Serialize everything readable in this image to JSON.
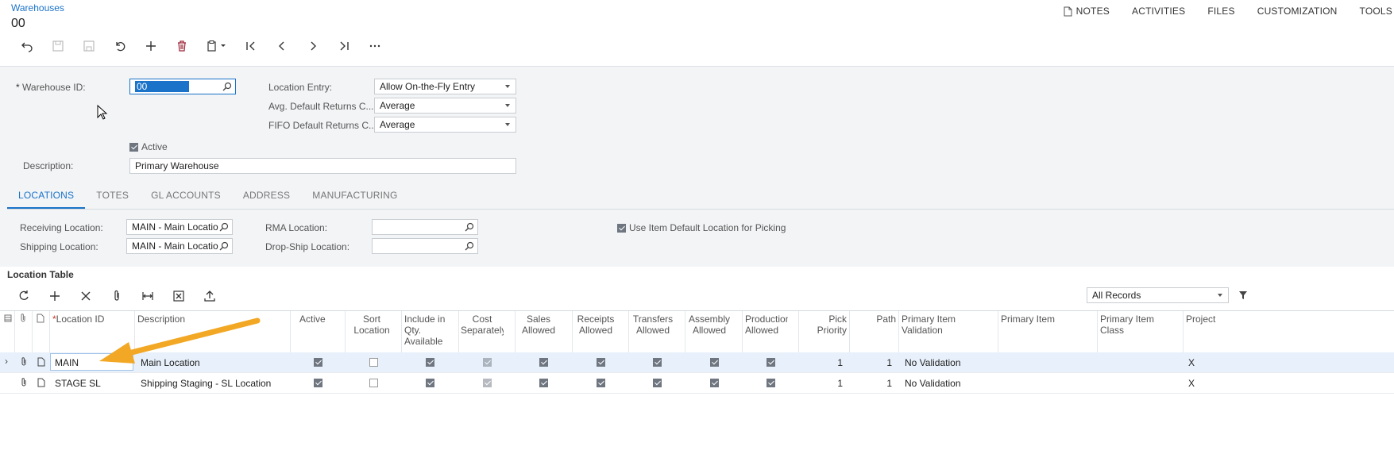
{
  "header": {
    "breadcrumb": "Warehouses",
    "record_title": "00",
    "top_links": [
      "NOTES",
      "ACTIVITIES",
      "FILES",
      "CUSTOMIZATION",
      "TOOLS"
    ]
  },
  "form": {
    "warehouse_id_label": "Warehouse ID:",
    "warehouse_id_value": "00",
    "location_entry_label": "Location Entry:",
    "location_entry_value": "Allow On-the-Fly Entry",
    "avg_returns_label": "Avg. Default Returns C...",
    "avg_returns_value": "Average",
    "fifo_returns_label": "FIFO Default Returns C...",
    "fifo_returns_value": "Average",
    "active_label": "Active",
    "active_checked": true,
    "description_label": "Description:",
    "description_value": "Primary Warehouse"
  },
  "tabs": [
    "LOCATIONS",
    "TOTES",
    "GL ACCOUNTS",
    "ADDRESS",
    "MANUFACTURING"
  ],
  "locations": {
    "receiving_label": "Receiving Location:",
    "receiving_value": "MAIN - Main Location",
    "shipping_label": "Shipping Location:",
    "shipping_value": "MAIN - Main Location",
    "rma_label": "RMA Location:",
    "rma_value": "",
    "dropship_label": "Drop-Ship Location:",
    "dropship_value": "",
    "use_item_default_label": "Use Item Default Location for Picking",
    "use_item_default_checked": true
  },
  "grid": {
    "title": "Location Table",
    "filter_value": "All Records",
    "columns": {
      "location_id": "Location ID",
      "description": "Description",
      "active": "Active",
      "sort_location": "Sort Location",
      "include_qty": "Include in Qty. Available",
      "cost_separately": "Cost Separately",
      "sales_allowed": "Sales Allowed",
      "receipts_allowed": "Receipts Allowed",
      "transfers_allowed": "Transfers Allowed",
      "assembly_allowed": "Assembly Allowed",
      "production_allowed": "Production Allowed",
      "pick_priority": "Pick Priority",
      "path": "Path",
      "primary_item_validation": "Primary Item Validation",
      "primary_item": "Primary Item",
      "primary_item_class": "Primary Item Class",
      "project": "Project"
    },
    "rows": [
      {
        "location_id": "MAIN",
        "description": "Main Location",
        "active": true,
        "sort_location": false,
        "include_qty": true,
        "cost_separately": true,
        "sales_allowed": true,
        "receipts_allowed": true,
        "transfers_allowed": true,
        "assembly_allowed": true,
        "production_allowed": true,
        "pick_priority": "1",
        "path": "1",
        "primary_item_validation": "No Validation",
        "primary_item": "",
        "primary_item_class": "",
        "project": "X"
      },
      {
        "location_id": "STAGE SL",
        "description": "Shipping Staging - SL Location",
        "active": true,
        "sort_location": false,
        "include_qty": true,
        "cost_separately": true,
        "sales_allowed": true,
        "receipts_allowed": true,
        "transfers_allowed": true,
        "assembly_allowed": true,
        "production_allowed": true,
        "pick_priority": "1",
        "path": "1",
        "primary_item_validation": "No Validation",
        "primary_item": "",
        "primary_item_class": "",
        "project": "X"
      }
    ]
  },
  "colors": {
    "accent": "#1a73c9",
    "annotation_arrow": "#f2a824",
    "selected_row": "#e8f1fb"
  }
}
